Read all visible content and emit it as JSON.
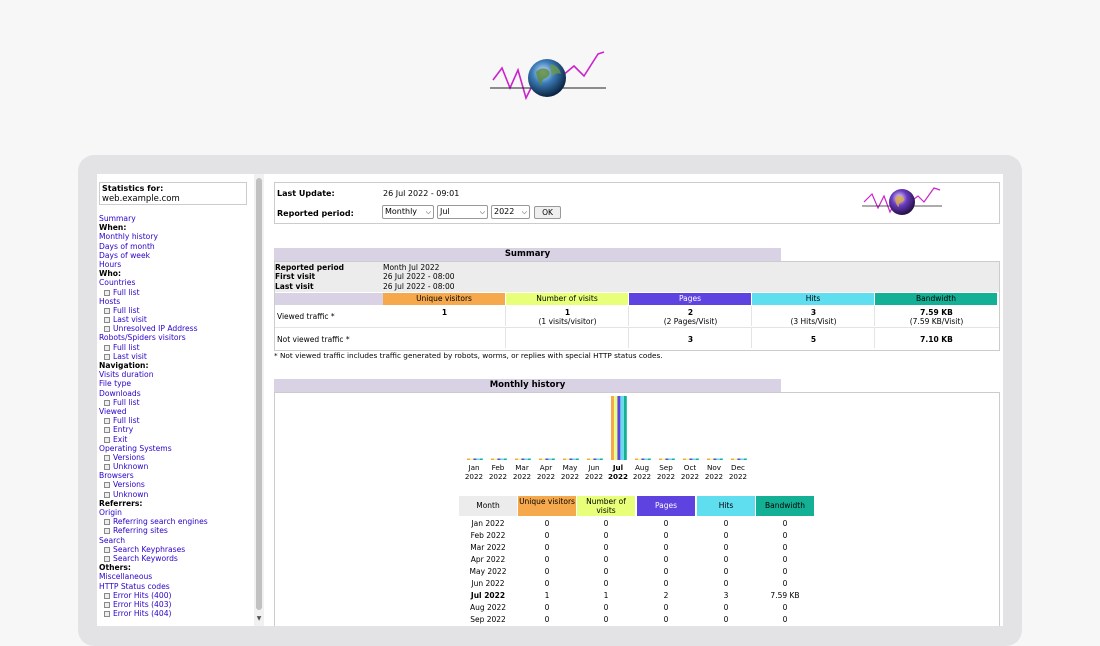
{
  "sidebar": {
    "stats_label": "Statistics for:",
    "host": "web.example.com",
    "menu": [
      {
        "type": "link",
        "label": "Summary"
      },
      {
        "type": "head",
        "label": "When:"
      },
      {
        "type": "link",
        "label": "Monthly history"
      },
      {
        "type": "link",
        "label": "Days of month"
      },
      {
        "type": "link",
        "label": "Days of week"
      },
      {
        "type": "link",
        "label": "Hours"
      },
      {
        "type": "head",
        "label": "Who:"
      },
      {
        "type": "link",
        "label": "Countries"
      },
      {
        "type": "sub",
        "label": "Full list"
      },
      {
        "type": "link",
        "label": "Hosts"
      },
      {
        "type": "sub",
        "label": "Full list"
      },
      {
        "type": "sub",
        "label": "Last visit"
      },
      {
        "type": "sub",
        "label": "Unresolved IP Address"
      },
      {
        "type": "link",
        "label": "Robots/Spiders visitors"
      },
      {
        "type": "sub",
        "label": "Full list"
      },
      {
        "type": "sub",
        "label": "Last visit"
      },
      {
        "type": "head",
        "label": "Navigation:"
      },
      {
        "type": "link",
        "label": "Visits duration"
      },
      {
        "type": "link",
        "label": "File type"
      },
      {
        "type": "link",
        "label": "Downloads"
      },
      {
        "type": "sub",
        "label": "Full list"
      },
      {
        "type": "link",
        "label": "Viewed"
      },
      {
        "type": "sub",
        "label": "Full list"
      },
      {
        "type": "sub",
        "label": "Entry"
      },
      {
        "type": "sub",
        "label": "Exit"
      },
      {
        "type": "link",
        "label": "Operating Systems"
      },
      {
        "type": "sub",
        "label": "Versions"
      },
      {
        "type": "sub",
        "label": "Unknown"
      },
      {
        "type": "link",
        "label": "Browsers"
      },
      {
        "type": "sub",
        "label": "Versions"
      },
      {
        "type": "sub",
        "label": "Unknown"
      },
      {
        "type": "head",
        "label": "Referrers:"
      },
      {
        "type": "link",
        "label": "Origin"
      },
      {
        "type": "sub",
        "label": "Referring search engines"
      },
      {
        "type": "sub",
        "label": "Referring sites"
      },
      {
        "type": "link",
        "label": "Search"
      },
      {
        "type": "sub",
        "label": "Search Keyphrases"
      },
      {
        "type": "sub",
        "label": "Search Keywords"
      },
      {
        "type": "head",
        "label": "Others:"
      },
      {
        "type": "link",
        "label": "Miscellaneous"
      },
      {
        "type": "link",
        "label": "HTTP Status codes"
      },
      {
        "type": "sub",
        "label": "Error Hits (400)"
      },
      {
        "type": "sub",
        "label": "Error Hits (403)"
      },
      {
        "type": "sub",
        "label": "Error Hits (404)"
      }
    ]
  },
  "header": {
    "last_update_label": "Last Update:",
    "last_update_value": "26 Jul 2022 - 09:01",
    "period_label": "Reported period:",
    "period_type": "Monthly",
    "period_month": "Jul",
    "period_year": "2022",
    "ok_label": "OK"
  },
  "summary": {
    "title": "Summary",
    "reported_period_label": "Reported period",
    "reported_period_value": "Month Jul 2022",
    "first_visit_label": "First visit",
    "first_visit_value": "26 Jul 2022 - 08:00",
    "last_visit_label": "Last visit",
    "last_visit_value": "26 Jul 2022 - 08:00",
    "columns": [
      "Unique visitors",
      "Number of visits",
      "Pages",
      "Hits",
      "Bandwidth"
    ],
    "column_colors": [
      "#f6a94c",
      "#e8ff7a",
      "#5e43e0",
      "#5fdef0",
      "#14b096"
    ],
    "viewed_label": "Viewed traffic *",
    "viewed": [
      "1",
      "1",
      "2",
      "3",
      "7.59 KB"
    ],
    "viewed_sub": [
      "",
      "(1 visits/visitor)",
      "(2 Pages/Visit)",
      "(3 Hits/Visit)",
      "(7.59 KB/Visit)"
    ],
    "not_viewed_label": "Not viewed traffic *",
    "not_viewed": [
      "",
      "",
      "3",
      "5",
      "7.10 KB"
    ],
    "note": "* Not viewed traffic includes traffic generated by robots, worms, or replies with special HTTP status codes."
  },
  "monthly": {
    "title": "Monthly history",
    "table_headers": [
      "Month",
      "Unique visitors",
      "Number of visits",
      "Pages",
      "Hits",
      "Bandwidth"
    ],
    "rows": [
      [
        "Jan 2022",
        "0",
        "0",
        "0",
        "0",
        "0"
      ],
      [
        "Feb 2022",
        "0",
        "0",
        "0",
        "0",
        "0"
      ],
      [
        "Mar 2022",
        "0",
        "0",
        "0",
        "0",
        "0"
      ],
      [
        "Apr 2022",
        "0",
        "0",
        "0",
        "0",
        "0"
      ],
      [
        "May 2022",
        "0",
        "0",
        "0",
        "0",
        "0"
      ],
      [
        "Jun 2022",
        "0",
        "0",
        "0",
        "0",
        "0"
      ],
      [
        "Jul 2022",
        "1",
        "1",
        "2",
        "3",
        "7.59 KB"
      ],
      [
        "Aug 2022",
        "0",
        "0",
        "0",
        "0",
        "0"
      ],
      [
        "Sep 2022",
        "0",
        "0",
        "0",
        "0",
        "0"
      ]
    ]
  },
  "chart_data": {
    "type": "bar",
    "categories": [
      "Jan 2022",
      "Feb 2022",
      "Mar 2022",
      "Apr 2022",
      "May 2022",
      "Jun 2022",
      "Jul 2022",
      "Aug 2022",
      "Sep 2022",
      "Oct 2022",
      "Nov 2022",
      "Dec 2022"
    ],
    "month_labels": [
      "Jan",
      "Feb",
      "Mar",
      "Apr",
      "May",
      "Jun",
      "Jul",
      "Aug",
      "Sep",
      "Oct",
      "Nov",
      "Dec"
    ],
    "year_label": "2022",
    "highlight_index": 6,
    "series": [
      {
        "name": "Unique visitors",
        "color": "#f6a94c",
        "values": [
          0,
          0,
          0,
          0,
          0,
          0,
          1,
          0,
          0,
          0,
          0,
          0
        ]
      },
      {
        "name": "Number of visits",
        "color": "#e8ff7a",
        "values": [
          0,
          0,
          0,
          0,
          0,
          0,
          1,
          0,
          0,
          0,
          0,
          0
        ]
      },
      {
        "name": "Pages",
        "color": "#5e43e0",
        "values": [
          0,
          0,
          0,
          0,
          0,
          0,
          2,
          0,
          0,
          0,
          0,
          0
        ]
      },
      {
        "name": "Hits",
        "color": "#5fdef0",
        "values": [
          0,
          0,
          0,
          0,
          0,
          0,
          3,
          0,
          0,
          0,
          0,
          0
        ]
      },
      {
        "name": "Bandwidth",
        "color": "#14b096",
        "values": [
          0,
          0,
          0,
          0,
          0,
          0,
          7.59,
          0,
          0,
          0,
          0,
          0
        ]
      }
    ]
  }
}
